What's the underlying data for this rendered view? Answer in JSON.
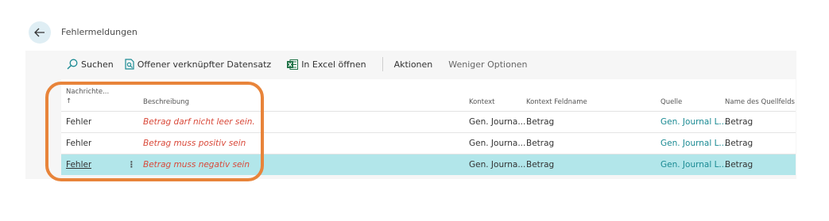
{
  "page": {
    "title": "Fehlermeldungen"
  },
  "toolbar": {
    "search_label": "Suchen",
    "open_related_label": "Offener verknüpfter Datensatz",
    "excel_label": "In Excel öffnen",
    "actions_label": "Aktionen",
    "fewer_options_label": "Weniger Optionen"
  },
  "table": {
    "columns": {
      "message_type": "Nachrichte...",
      "sort_indicator": "↑",
      "description": "Beschreibung",
      "context": "Kontext",
      "context_field": "Kontext Feldname",
      "source": "Quelle",
      "source_field": "Name des Quellfelds"
    },
    "rows": [
      {
        "type": "Fehler",
        "description": "Betrag darf nicht leer sein.",
        "context": "Gen. Journa...",
        "context_field": "Betrag",
        "source": "Gen. Journal L...",
        "source_field": "Betrag"
      },
      {
        "type": "Fehler",
        "description": "Betrag muss positiv sein",
        "context": "Gen. Journa...",
        "context_field": "Betrag",
        "source": "Gen. Journal L...",
        "source_field": "Betrag"
      },
      {
        "type": "Fehler",
        "description": "Betrag muss negativ sein",
        "context": "Gen. Journa...",
        "context_field": "Betrag",
        "source": "Gen. Journal L...",
        "source_field": "Betrag",
        "selected": true,
        "row_menu": "⋮"
      }
    ]
  },
  "colors": {
    "accent": "#1a8a93",
    "error_text": "#d9493a",
    "selection": "#b2e6ea",
    "annotation": "#e8843a"
  },
  "icons": {
    "back": "arrow-left-icon",
    "search": "search-icon",
    "open_related": "open-record-icon",
    "excel": "excel-icon"
  }
}
